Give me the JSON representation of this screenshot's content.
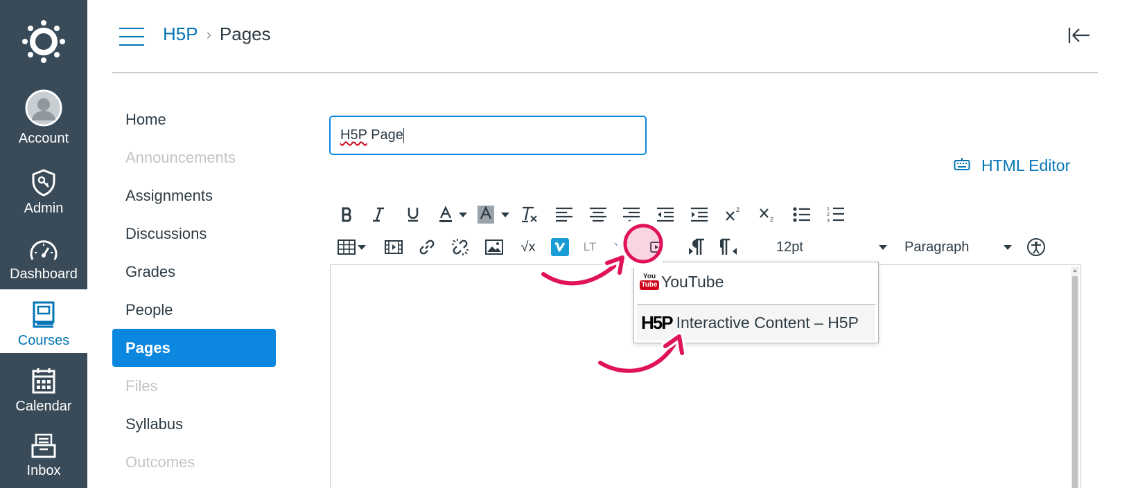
{
  "global_nav": {
    "items": [
      {
        "label": "Account",
        "icon": "avatar-icon"
      },
      {
        "label": "Admin",
        "icon": "shield-icon"
      },
      {
        "label": "Dashboard",
        "icon": "speedometer-icon"
      },
      {
        "label": "Courses",
        "icon": "book-icon",
        "active": true
      },
      {
        "label": "Calendar",
        "icon": "calendar-icon"
      },
      {
        "label": "Inbox",
        "icon": "inbox-icon"
      }
    ]
  },
  "breadcrumb": {
    "course": "H5P",
    "separator": "›",
    "current": "Pages"
  },
  "course_nav": {
    "items": [
      {
        "label": "Home",
        "state": "normal"
      },
      {
        "label": "Announcements",
        "state": "disabled"
      },
      {
        "label": "Assignments",
        "state": "normal"
      },
      {
        "label": "Discussions",
        "state": "normal"
      },
      {
        "label": "Grades",
        "state": "normal"
      },
      {
        "label": "People",
        "state": "normal"
      },
      {
        "label": "Pages",
        "state": "active"
      },
      {
        "label": "Files",
        "state": "disabled"
      },
      {
        "label": "Syllabus",
        "state": "normal"
      },
      {
        "label": "Outcomes",
        "state": "disabled"
      }
    ]
  },
  "editor": {
    "title_value_misspelled": "H5P",
    "title_value_rest": " Page",
    "html_editor_label": "HTML Editor",
    "font_size": "12pt",
    "block_format": "Paragraph",
    "sqrt_label": "√x",
    "ltr_label": "LT"
  },
  "dropdown": {
    "items": [
      {
        "label": "YouTube",
        "icon": "youtube-icon"
      },
      {
        "label": "Interactive Content – H5P",
        "icon": "h5p-icon"
      }
    ],
    "youtube_logo_top": "You",
    "youtube_logo_bottom": "Tube",
    "h5p_logo_text": "H5P"
  },
  "colors": {
    "nav_bg": "#394b58",
    "brand_blue": "#0374b5",
    "active_blue": "#0b87e0",
    "annotation_pink": "#e0135a"
  }
}
